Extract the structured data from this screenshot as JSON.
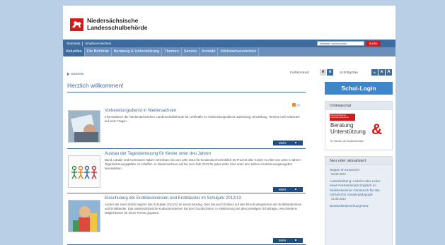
{
  "logo": {
    "line1": "Niedersächsische",
    "line2": "Landesschulbehörde"
  },
  "topbar": {
    "links": [
      "Startseite",
      "Inhaltsverzeichnis"
    ],
    "search_placeholder": "Website durchsuchen",
    "search_button": "Suche"
  },
  "mainnav": [
    "Aktuelles",
    "Die Behörde",
    "Beratung & Unterstützung",
    "Themen",
    "Service",
    "Kontakt",
    "Stichwortverzeichnis"
  ],
  "breadcrumb": "Startseite",
  "tools": {
    "contrast_label": "Farbkontrast",
    "contrast_a1": "A",
    "contrast_a2": "A",
    "fontsize_label": "Schriftgröße",
    "font_a1": "A",
    "font_a2": "A",
    "font_a3": "A"
  },
  "heading": "Herzlich willkommen!",
  "articles": [
    {
      "title": "Vorbereitungsdienst in Niedersachsen",
      "text": "Informationen der Niedersächsischen Landesschulbehörde für Lehrkräfte im Vorbereitungsdienst: Zulassung, Einstellung, Termine und Antworten auf viele Fragen.",
      "more": "Mehr"
    },
    {
      "title": "Ausbau der Tagesbetreuung für Kinder unter drei Jahren",
      "text": "Bund, Länder und Kommunen haben vereinbart, bis zum Jahr 2013 für bundesdurchschnittlich 35 Prozent aller Kinder im Alter von unter 3 Jahren Tagesbetreuungsplätze zu schaffen. In Niedersachsen soll bis zum Jahr 2013 für jedes dritte Kind unter drei Jahren ein Betreuungsangebot bereitstehen.",
      "more": "Mehr"
    },
    {
      "title": "Einschulung der Erstklässlerinnen und Erstklässler im Schuljahr 2012/13",
      "text": "Anders als sonst üblich beginnt das Schuljahr 2012/13 an einem Montag. Dies hat auch Einfluss auf den Einschulungstermin der Erstklässlerinnen und Erstklässler. Das Niedersächsische Kultusministerium hat den Grundschulen, in Abstimmung mit dem jeweiligen Schulträger, verschiedene Möglichkeiten für einen Termin gegeben.",
      "more": "Mehr"
    }
  ],
  "sidebar": {
    "login": "Schul-Login",
    "onlineportal_head": "Onlineportal",
    "ob_top": "Niedersächsische Landesschulbehörde",
    "ob_line1": "Beratung",
    "ob_line2": "Unterstützung",
    "ob_amp": "&",
    "ob_small": "für Schulen und Studienseminare",
    "news_head": "Neu oder aktualisiert",
    "news": [
      {
        "title": "Region im Unterricht",
        "date": "29.08.2012"
      },
      {
        "title": "Ausschreibung: Leiterin oder Leiter eines Fachseminars Englisch im Studienseminar Osnabrück für das Lehramt für Sonderpädagogik",
        "date": "21.08.2012"
      },
      {
        "title": "Bundeskinderschutzgesetz",
        "date": ""
      }
    ]
  }
}
